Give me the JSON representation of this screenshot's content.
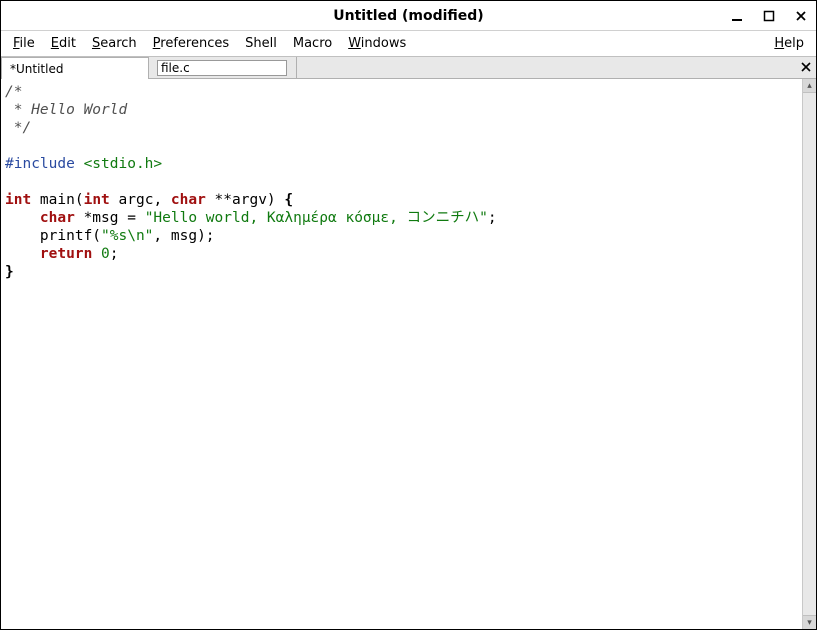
{
  "window": {
    "title": "Untitled (modified)"
  },
  "menu": {
    "file": "File",
    "edit": "Edit",
    "search": "Search",
    "preferences": "Preferences",
    "shell": "Shell",
    "macro": "Macro",
    "windows": "Windows",
    "help": "Help"
  },
  "tabs": {
    "active_label": "*Untitled",
    "input_value": "file.c"
  },
  "code": {
    "l1": "/*",
    "l2": " * Hello World",
    "l3": " */",
    "l4": "",
    "l5a": "#include ",
    "l5b": "<stdio.h>",
    "l6": "",
    "l7_int": "int",
    "l7_main": " main(",
    "l7_int2": "int",
    "l7_argc": " argc, ",
    "l7_char": "char",
    "l7_argv": " **argv) ",
    "l7_brace": "{",
    "l8_pad": "    ",
    "l8_char": "char",
    "l8_msg": " *msg = ",
    "l8_str": "\"Hello world, Καλημέρα κόσμε, コンニチハ\"",
    "l8_semi": ";",
    "l9_pad": "    printf(",
    "l9_str": "\"%s\\n\"",
    "l9_rest": ", msg);",
    "l10_pad": "    ",
    "l10_ret": "return",
    "l10_sp": " ",
    "l10_zero": "0",
    "l10_semi": ";",
    "l11": "}"
  }
}
